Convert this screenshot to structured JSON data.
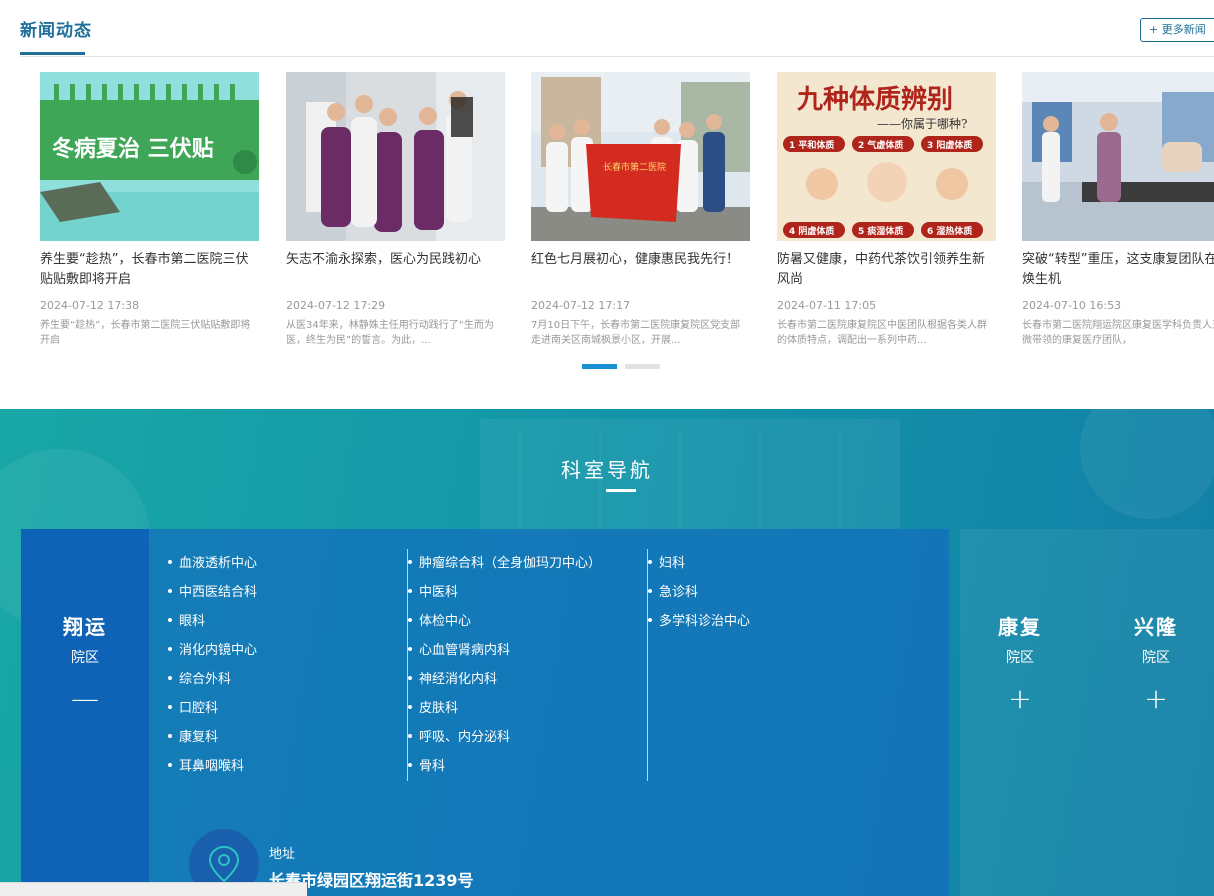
{
  "news": {
    "title": "新闻动态",
    "more_label": "+ 更多新闻",
    "items": [
      {
        "title": "养生要“趁热”，长春市第二医院三伏贴贴敷即将开启",
        "date": "2024-07-12 17:38",
        "summary": "养生要“趁热”，长春市第二医院三伏贴贴敷即将开启",
        "image_text": "冬病夏治 三伏贴"
      },
      {
        "title": "矢志不渝永探索，医心为民践初心",
        "date": "2024-07-12 17:29",
        "summary": "从医34年来，林静姝主任用行动践行了“生而为医，终生为民”的誓言。为此，..."
      },
      {
        "title": "红色七月展初心，健康惠民我先行！",
        "date": "2024-07-12 17:17",
        "summary": "7月10日下午，长春市第二医院康复院区党支部走进南关区南城枫景小区，开展..."
      },
      {
        "title": "防暑又健康，中药代茶饮引领养生新风尚",
        "date": "2024-07-11 17:05",
        "summary": "长春市第二医院康复院区中医团队根据各类人群的体质特点，调配出一系列中药...",
        "image_text": "九种体质辨别",
        "image_subtext": "——你属于哪种?",
        "image_labels": [
          "1 平和体质",
          "2 气虚体质",
          "3 阳虚体质",
          "4 阴虚体质",
          "5 痰湿体质",
          "6 湿热体质"
        ]
      },
      {
        "title": "突破“转型”重压，这支康复团队在重焕生机",
        "date": "2024-07-10 16:53",
        "summary": "长春市第二医院翔运院区康复医学科负责人王微微带领的康复医疗团队，"
      }
    ]
  },
  "departments": {
    "title": "科室导航",
    "active_campus": {
      "name": "翔运",
      "sub": "院区",
      "toggle": "—"
    },
    "columns": [
      [
        "血液透析中心",
        "中西医结合科",
        "眼科",
        "消化内镜中心",
        "综合外科",
        "口腔科",
        "康复科",
        "耳鼻咽喉科"
      ],
      [
        "肿瘤综合科（全身伽玛刀中心）",
        "中医科",
        "体检中心",
        "心血管肾病内科",
        "神经消化内科",
        "皮肤科",
        "呼吸、内分泌科",
        "骨科"
      ],
      [
        "妇科",
        "急诊科",
        "多学科诊治中心"
      ]
    ],
    "address_label": "地址",
    "address_value": "长春市绿园区翔运街1239号",
    "other_campuses": [
      {
        "name": "康复",
        "sub": "院区",
        "toggle": "+"
      },
      {
        "name": "兴隆",
        "sub": "院区",
        "toggle": "+"
      }
    ]
  },
  "colors": {
    "accent": "#1f6f98",
    "dot_active": "#1b8fd4",
    "dept_bg_start": "#19a7a6",
    "dept_bg_end": "#127fa7",
    "campus_active": "#0f63b6"
  }
}
